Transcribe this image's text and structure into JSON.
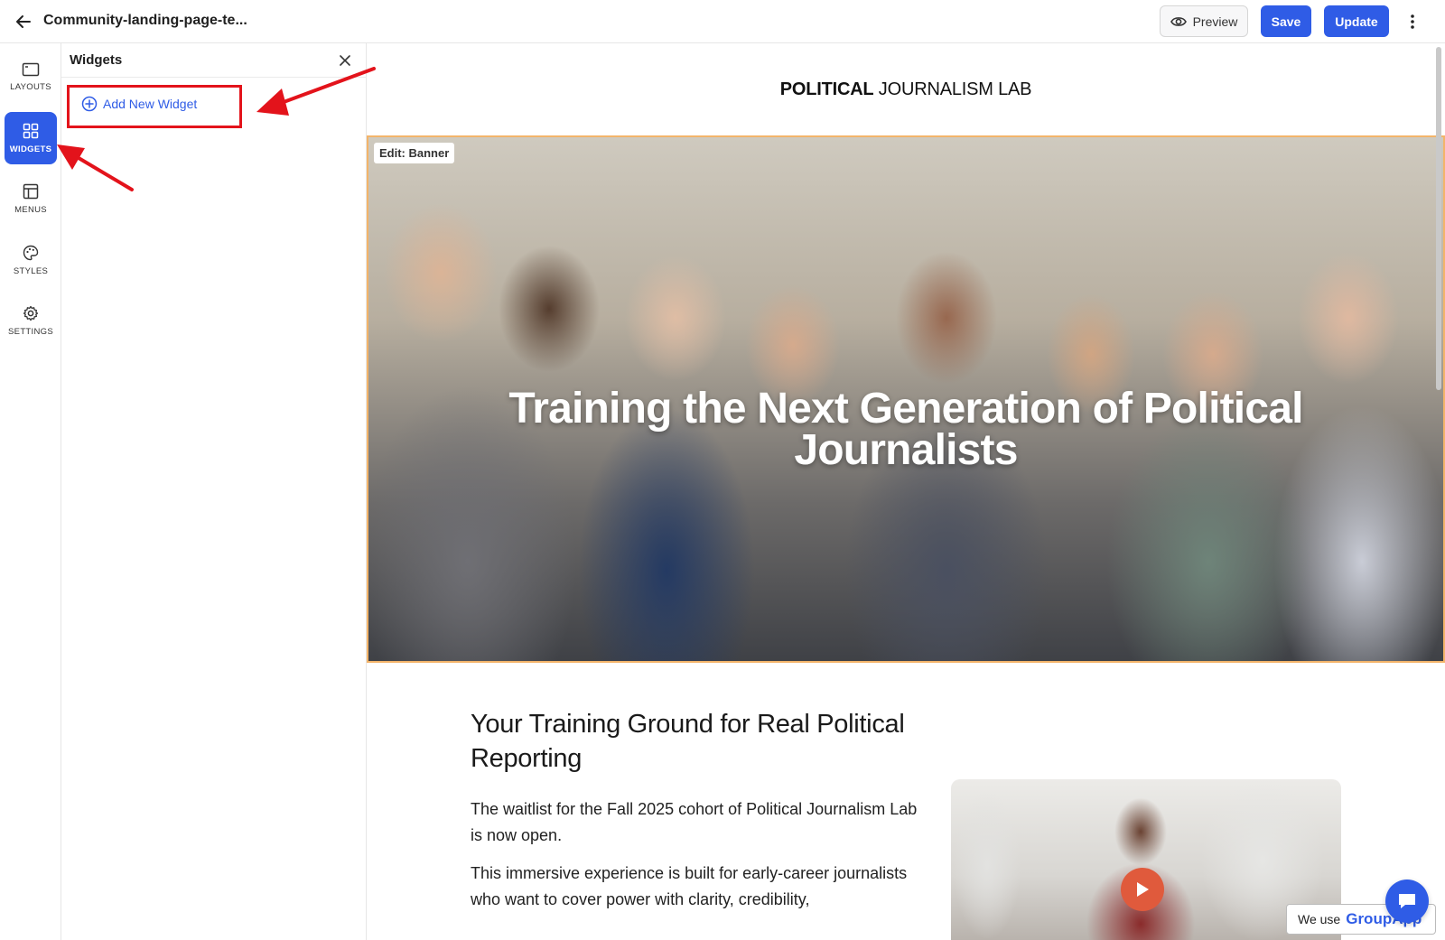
{
  "topbar": {
    "back_icon": "arrow-left-icon",
    "title": "Community-landing-page-te...",
    "preview_label": "Preview",
    "preview_icon": "eye-icon",
    "save_label": "Save",
    "update_label": "Update",
    "more_icon": "kebab-menu-icon"
  },
  "rail": {
    "items": [
      {
        "label": "LAYOUTS",
        "icon": "layout-icon",
        "active": false
      },
      {
        "label": "WIDGETS",
        "icon": "grid-icon",
        "active": true
      },
      {
        "label": "MENUS",
        "icon": "menu-panel-icon",
        "active": false
      },
      {
        "label": "STYLES",
        "icon": "palette-icon",
        "active": false
      },
      {
        "label": "SETTINGS",
        "icon": "gear-icon",
        "active": false
      }
    ]
  },
  "panel": {
    "title": "Widgets",
    "close_icon": "close-icon",
    "add_widget_label": "Add New Widget",
    "add_widget_icon": "plus-circle-icon"
  },
  "canvas": {
    "site_title_bold": "POLITICAL",
    "site_title_rest": " JOURNALISM LAB",
    "banner_tag": "Edit: Banner",
    "banner_heading": "Training the Next Generation of Political Journalists",
    "section_heading": "Your Training Ground for Real Political Reporting",
    "para1": "The waitlist for the Fall 2025 cohort of Political Journalism Lab is now open.",
    "para2": "This immersive experience is built for early-career journalists who want to cover power with clarity, credibility,",
    "video_play_icon": "play-icon"
  },
  "widgets": {
    "chat_icon": "chat-bubble-icon",
    "cookie_text": "We use",
    "cookie_brand": "GroupApp"
  },
  "colors": {
    "accent": "#2f5ce6",
    "annotation": "#e3131b",
    "banner_border": "#f3b46a",
    "play": "#e05a3c"
  }
}
